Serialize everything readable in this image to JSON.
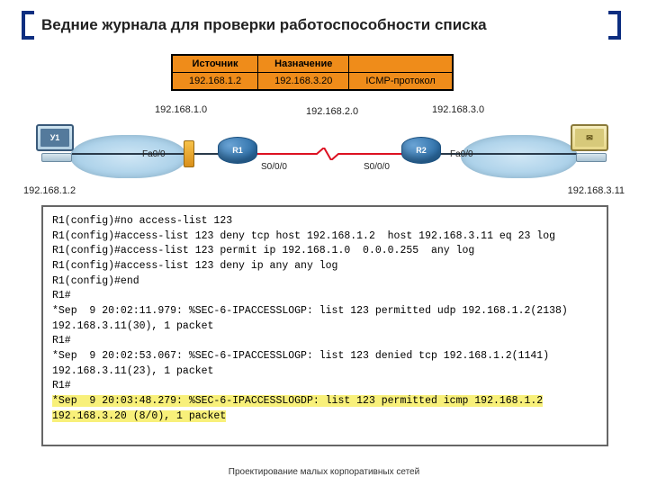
{
  "title": "Ведние журнала для проверки работоспособности списка",
  "packet_table": {
    "headers": {
      "source": "Источник",
      "dest": "Назначение",
      "col3": ""
    },
    "row": {
      "source": "192.168.1.2",
      "dest": "192.168.3.20",
      "col3": "ICMP-протокол"
    }
  },
  "topology": {
    "host_left_label": "У1",
    "host_left_ip": "192.168.1.2",
    "host_right_ip": "192.168.3.11",
    "router1": "R1",
    "router2": "R2",
    "subnet_left": "192.168.1.0",
    "subnet_mid": "192.168.2.0",
    "subnet_right": "192.168.3.0",
    "intf_fa00_left": "Fa0/0",
    "intf_s000_r1": "S0/0/0",
    "intf_s000_r2": "S0/0/0",
    "intf_fa00_right": "Fa0/0"
  },
  "terminal": {
    "lines": [
      "R1(config)#no access-list 123",
      "R1(config)#access-list 123 deny tcp host 192.168.1.2  host 192.168.3.11 eq 23 log",
      "R1(config)#access-list 123 permit ip 192.168.1.0  0.0.0.255  any log",
      "R1(config)#access-list 123 deny ip any any log",
      "R1(config)#end",
      "R1#",
      "",
      "*Sep  9 20:02:11.979: %SEC-6-IPACCESSLOGP: list 123 permitted udp 192.168.1.2(2138)",
      "192.168.3.11(30), 1 packet",
      "R1#",
      "*Sep  9 20:02:53.067: %SEC-6-IPACCESSLOGP: list 123 denied tcp 192.168.1.2(1141)",
      "192.168.3.11(23), 1 packet",
      "R1#"
    ],
    "hl1": "*Sep  9 20:03:48.279: %SEC-6-IPACCESSLOGDP: list 123 permitted icmp 192.168.1.2",
    "hl2": "192.168.3.20 (8/0), 1 packet"
  },
  "footer": "Проектирование малых корпоративных сетей"
}
